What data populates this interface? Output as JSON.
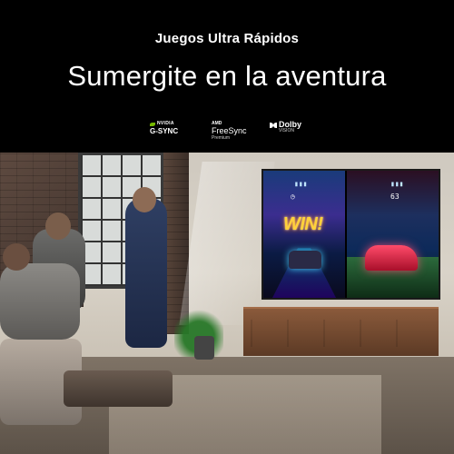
{
  "header": {
    "kicker": "Juegos Ultra Rápidos",
    "headline": "Sumergite en la aventura"
  },
  "logos": {
    "nvidia": {
      "brand": "NVIDIA",
      "name": "G-SYNC"
    },
    "amd": {
      "brand": "AMD",
      "name": "FreeSync",
      "tier": "Premium"
    },
    "dolby": {
      "brand": "Dolby",
      "tier": "VISION"
    }
  },
  "tv": {
    "left_overlay": "WIN!",
    "right_hud_value": "63"
  },
  "colors": {
    "background": "#000000",
    "text": "#ffffff",
    "nvidia_green": "#76b900",
    "win_gold": "#ffd23a"
  }
}
